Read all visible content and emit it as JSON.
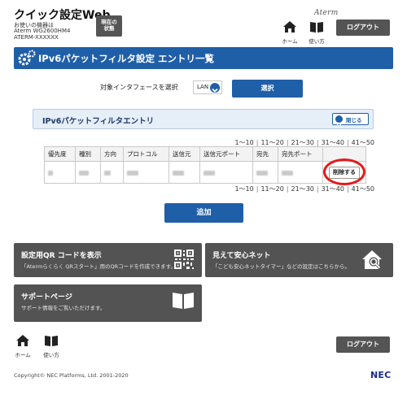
{
  "header": {
    "app_title": "クイック設定Web",
    "device_label": "お使いの機器は",
    "device_model": "Aterm WG2600HM4",
    "device_id": "ATERM-XXXXXX",
    "status_button": [
      "現在の",
      "状態"
    ],
    "brand": "Aterm",
    "home_label": "ホーム",
    "manual_label": "使い方",
    "logout_label": "ログアウト",
    "icons": {
      "home": "home-icon",
      "manual": "book-icon"
    }
  },
  "page_title": "IPv6パケットフィルタ設定 エントリ一覧",
  "interface": {
    "label": "対象インタフェースを選択",
    "selected_value": "LAN",
    "select_button": "選択"
  },
  "section": {
    "title": "IPv6パケットフィルタエントリ",
    "collapse_label": "閉じる"
  },
  "pagination": [
    "1～10",
    "11～20",
    "21～30",
    "31～40",
    "41～50"
  ],
  "table": {
    "columns": [
      "優先度",
      "種別",
      "方向",
      "プロトコル",
      "送信元",
      "送信元ポート",
      "宛先",
      "宛先ポート",
      ""
    ],
    "delete_label": "削除する"
  },
  "add_button": "追加",
  "tiles": {
    "qr": {
      "title": "設定用QR コードを表示",
      "desc": "「Atermらくらく QRスタート」用のQRコードを作成できます。",
      "icon": "qr-code-icon"
    },
    "safe": {
      "title": "見えて安心ネット",
      "desc": "「こども安心ネットタイマー」などの設定はこちらから。",
      "icon": "home-search-icon"
    },
    "support": {
      "title": "サポートページ",
      "desc": "サポート情報をご覧いただけます。",
      "icon": "book-icon"
    }
  },
  "footer": {
    "home_label": "ホーム",
    "manual_label": "使い方",
    "logout_label": "ログアウト",
    "copyright": "Copyright© NEC Platforms, Ltd. 2001-2020",
    "logo": "NEC"
  },
  "colors": {
    "primary": "#1f5fa8",
    "dark_tile": "#535353",
    "highlight": "#e21b1b",
    "nec_blue": "#1b2c8f"
  }
}
